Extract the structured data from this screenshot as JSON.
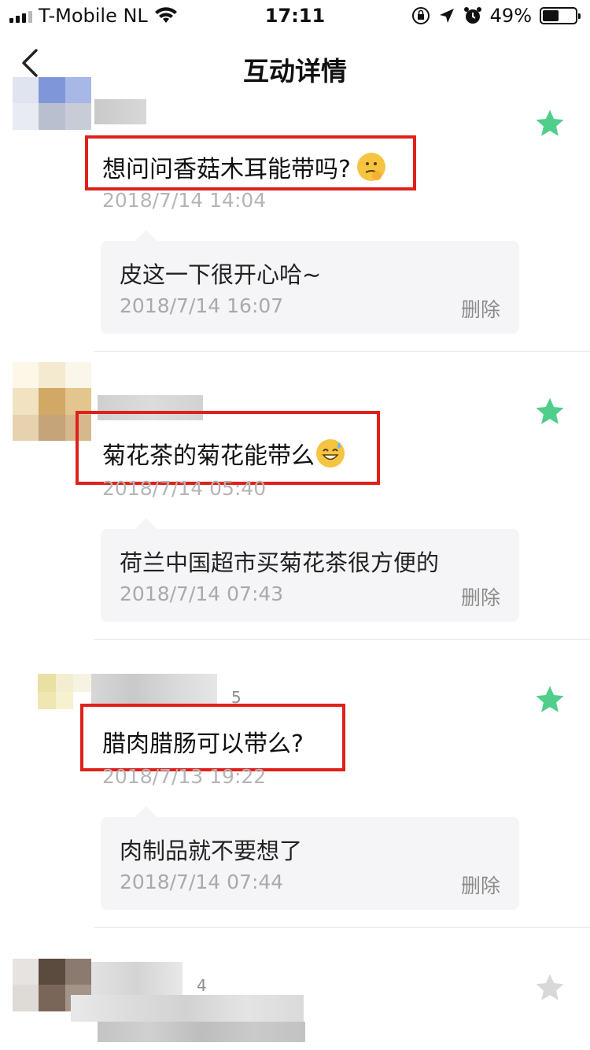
{
  "status_bar": {
    "carrier": "T-Mobile NL",
    "time": "17:11",
    "battery": "49%",
    "battery_level": 0.49
  },
  "nav": {
    "title": "互动详情",
    "back_icon": "chevron-left-icon"
  },
  "messages": [
    {
      "question": "想问问香菇木耳能带吗?",
      "emoji": "thinking-face-emoji",
      "time": "2018/7/14 14:04",
      "starred": true,
      "reply": "皮这一下很开心哈~",
      "reply_time": "2018/7/14 16:07",
      "delete_label": "删除"
    },
    {
      "question": "菊花茶的菊花能带么",
      "emoji": "grinning-sweat-emoji",
      "time": "2018/7/14 05:40",
      "starred": true,
      "reply": "荷兰中国超市买菊花茶很方便的",
      "reply_time": "2018/7/14 07:43",
      "delete_label": "删除"
    },
    {
      "question": "腊肉腊肠可以带么?",
      "time": "2018/7/13 19:22",
      "count": "5",
      "starred": true,
      "reply": "肉制品就不要想了",
      "reply_time": "2018/7/14 07:44",
      "delete_label": "删除"
    },
    {
      "count": "4",
      "starred": false
    }
  ],
  "colors": {
    "star_active": "#4fcf8a",
    "star_inactive": "#d8d8d8",
    "highlight_border": "#e0201b",
    "bubble_bg": "#f5f5f7"
  }
}
